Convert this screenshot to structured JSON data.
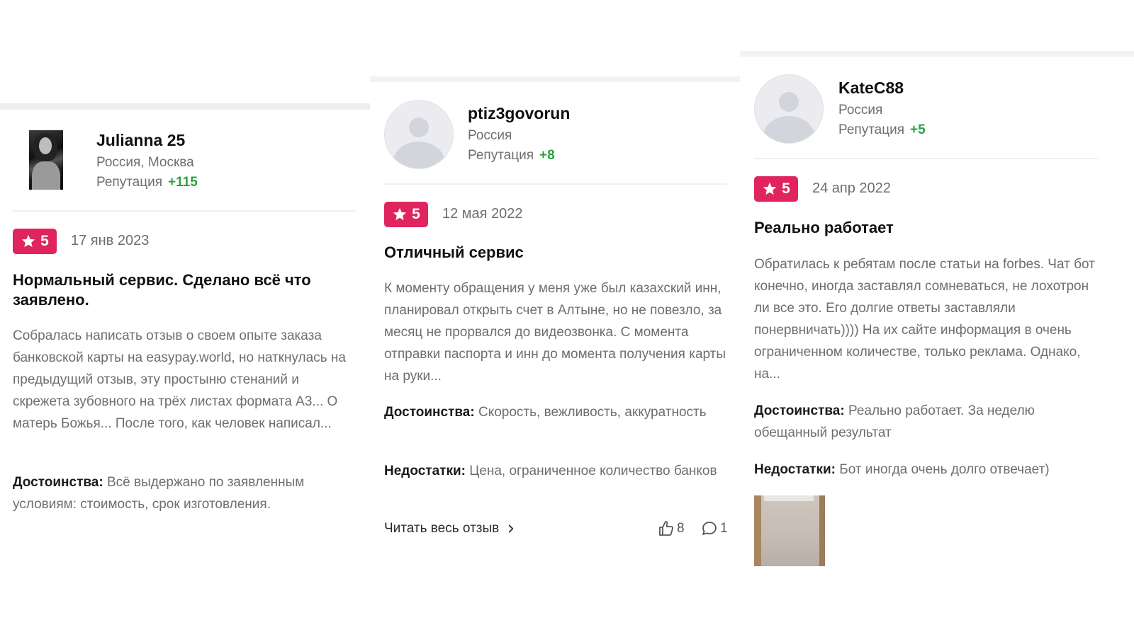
{
  "reviews": [
    {
      "user": {
        "name": "Julianna 25",
        "location": "Россия, Москва",
        "reputation_label": "Репутация",
        "reputation_value": "+115",
        "avatar": "photo"
      },
      "rating": "5",
      "date": "17 янв 2023",
      "title": "Нормальный сервис. Сделано всё что заявлено.",
      "text": "Собралась написать отзыв о своем опыте заказа банковской карты на easypay.world, но наткнулась на предыдущий отзыв, эту простыню стенаний и скрежета зубовного на трёх листах формата А3... О матерь Божья... После того, как человек написал...",
      "pros_label": "Достоинства:",
      "pros": "Всё выдержано по заявленным условиям: стоимость, срок изготовления."
    },
    {
      "user": {
        "name": "ptiz3govorun",
        "location": "Россия",
        "reputation_label": "Репутация",
        "reputation_value": "+8",
        "avatar": "default"
      },
      "rating": "5",
      "date": "12 мая 2022",
      "title": "Отличный сервис",
      "text": "К моменту обращения у меня уже был казахский инн, планировал открыть счет в Алтыне, но не повезло, за месяц не прорвался до видеозвонка. С момента отправки паспорта и инн до момента получения карты на руки...",
      "pros_label": "Достоинства:",
      "pros": "Скорость, вежливость, аккуратность",
      "cons_label": "Недостатки:",
      "cons": "Цена, ограниченное количество банков",
      "read_more": "Читать весь отзыв",
      "likes": "8",
      "comments": "1"
    },
    {
      "user": {
        "name": "KateC88",
        "location": "Россия",
        "reputation_label": "Репутация",
        "reputation_value": "+5",
        "avatar": "default"
      },
      "rating": "5",
      "date": "24 апр 2022",
      "title": "Реально работает",
      "text": "Обратилась к ребятам после статьи на forbes. Чат бот конечно, иногда заставлял сомневаться, не лохотрон ли все это. Его долгие ответы заставляли понервничать)))) На их сайте информация в очень ограниченном количестве, только реклама. Однако, на...",
      "pros_label": "Достоинства:",
      "pros": "Реально работает. За неделю обещанный результат",
      "cons_label": "Недостатки:",
      "cons": "Бот иногда очень долго отвечает)"
    }
  ],
  "colors": {
    "badge": "#e0245e",
    "reputation": "#2ea043",
    "muted_text": "#6e6e6e"
  },
  "icons": [
    "star-icon",
    "thumbs-up-icon",
    "comment-icon",
    "chevron-right-icon",
    "user-placeholder-icon"
  ]
}
